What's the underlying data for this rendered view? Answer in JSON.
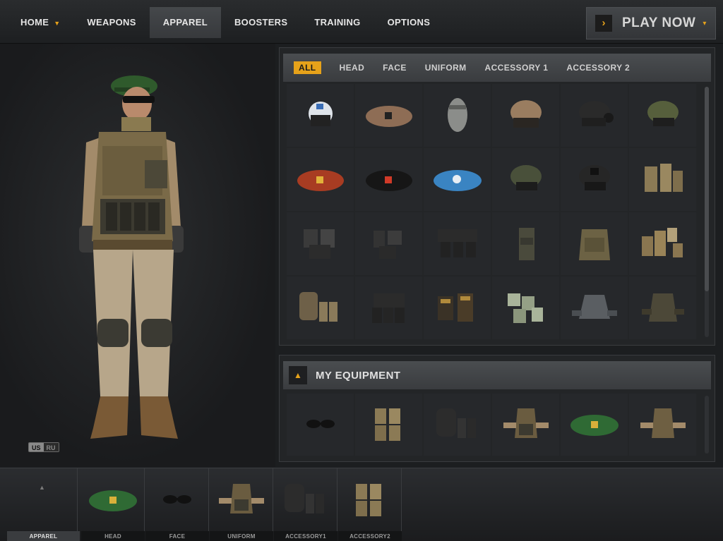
{
  "nav": {
    "items": [
      {
        "label": "HOME",
        "has_caret": true
      },
      {
        "label": "WEAPONS"
      },
      {
        "label": "APPAREL",
        "active": true
      },
      {
        "label": "BOOSTERS"
      },
      {
        "label": "TRAINING"
      },
      {
        "label": "OPTIONS"
      }
    ],
    "play_now": {
      "label": "PLAY NOW",
      "arrow": "›",
      "caret": "▾"
    }
  },
  "faction_toggle": {
    "options": [
      "US",
      "RU"
    ],
    "selected": "US"
  },
  "catalog": {
    "tabs": [
      "ALL",
      "HEAD",
      "FACE",
      "UNIFORM",
      "ACCESSORY 1",
      "ACCESSORY 2"
    ],
    "active_tab": "ALL",
    "items": [
      {
        "icon": "pilot-helmet-icon"
      },
      {
        "icon": "tan-beret-icon"
      },
      {
        "icon": "face-wrap-icon"
      },
      {
        "icon": "camo-helmet-icon"
      },
      {
        "icon": "headset-helmet-icon"
      },
      {
        "icon": "olive-helmet-icon"
      },
      {
        "icon": "red-beret-icon"
      },
      {
        "icon": "black-beret-icon"
      },
      {
        "icon": "blue-beret-icon"
      },
      {
        "icon": "green-helmet-icon"
      },
      {
        "icon": "nightvision-helmet-icon"
      },
      {
        "icon": "tan-pouches-icon"
      },
      {
        "icon": "holster-rig-icon"
      },
      {
        "icon": "leg-holster-icon"
      },
      {
        "icon": "black-chest-rig-icon"
      },
      {
        "icon": "utility-pouch-icon"
      },
      {
        "icon": "plate-carrier-icon"
      },
      {
        "icon": "coyote-pouches-icon"
      },
      {
        "icon": "backpack-pouches-icon"
      },
      {
        "icon": "black-backpack-icon"
      },
      {
        "icon": "mag-pouches-icon"
      },
      {
        "icon": "ammo-pouches-icon"
      },
      {
        "icon": "grey-jacket-icon"
      },
      {
        "icon": "camo-jacket-icon"
      }
    ],
    "colors": {
      "accent": "#e6a21a",
      "panel": "#232527",
      "cell": "#26282b"
    }
  },
  "my_equipment": {
    "title": "MY EQUIPMENT",
    "items": [
      {
        "icon": "sunglasses-icon"
      },
      {
        "icon": "tan-pouches-icon"
      },
      {
        "icon": "black-vest-rig-icon"
      },
      {
        "icon": "desert-vest-icon"
      },
      {
        "icon": "green-beret-icon"
      },
      {
        "icon": "desert-vest-alt-icon"
      }
    ]
  },
  "loadout": {
    "slots": [
      {
        "label": "APPAREL",
        "icon": "up-arrow-icon",
        "active": true
      },
      {
        "label": "HEAD",
        "icon": "green-beret-icon"
      },
      {
        "label": "FACE",
        "icon": "sunglasses-icon"
      },
      {
        "label": "UNIFORM",
        "icon": "desert-vest-icon"
      },
      {
        "label": "ACCESSORY1",
        "icon": "black-vest-rig-icon"
      },
      {
        "label": "ACCESSORY2",
        "icon": "tan-pouches-icon"
      }
    ]
  }
}
